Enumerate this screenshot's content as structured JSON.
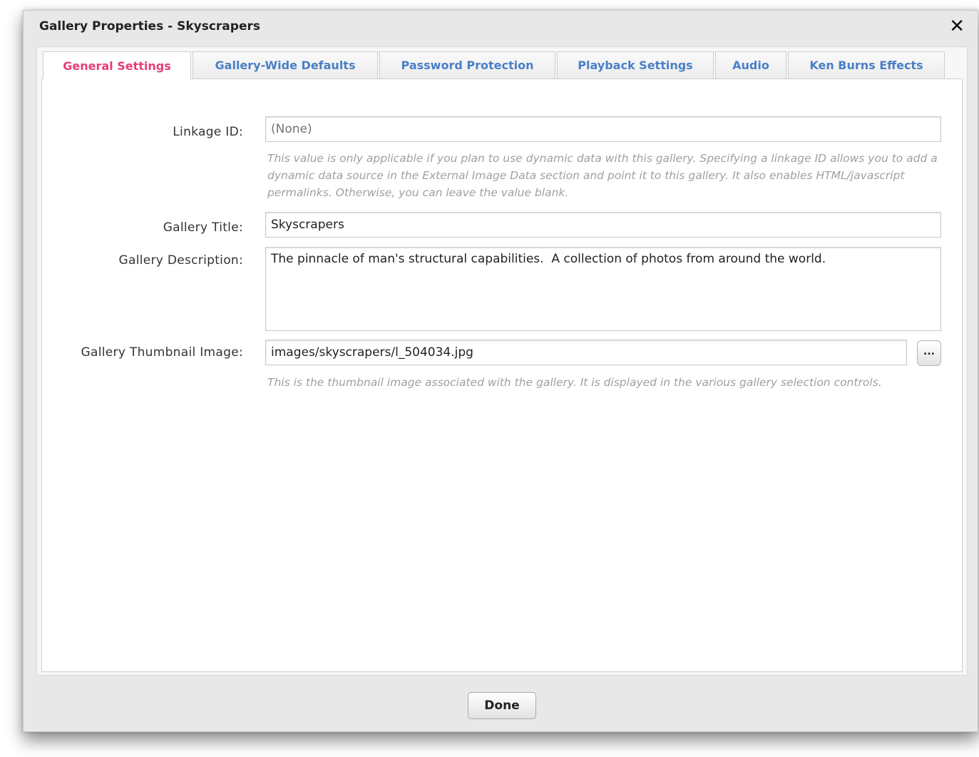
{
  "dialog": {
    "title": "Gallery Properties - Skyscrapers",
    "close_icon": "✕"
  },
  "tabs": [
    {
      "label": "General Settings",
      "active": true
    },
    {
      "label": "Gallery-Wide Defaults",
      "active": false
    },
    {
      "label": "Password Protection",
      "active": false
    },
    {
      "label": "Playback Settings",
      "active": false
    },
    {
      "label": "Audio",
      "active": false
    },
    {
      "label": "Ken Burns Effects",
      "active": false
    }
  ],
  "form": {
    "linkage": {
      "label": "Linkage ID:",
      "placeholder": "(None)",
      "value": "",
      "hint": "This value is only applicable if you plan to use dynamic data with this gallery.  Specifying a linkage ID allows you to add a dynamic data source in the External Image Data section and point it to this gallery. It also enables HTML/javascript permalinks.  Otherwise, you can leave the value blank."
    },
    "title": {
      "label": "Gallery Title:",
      "value": "Skyscrapers"
    },
    "description": {
      "label": "Gallery Description:",
      "value": "The pinnacle of man's structural capabilities.  A collection of photos from around the world."
    },
    "thumbnail": {
      "label": "Gallery Thumbnail Image:",
      "value": "images/skyscrapers/l_504034.jpg",
      "browse_label": "...",
      "hint": "This is the thumbnail image associated with the gallery.  It is displayed in the various gallery selection controls."
    }
  },
  "footer": {
    "done_label": "Done"
  },
  "colors": {
    "active_tab": "#e63d79",
    "inactive_tab": "#4a7fc6"
  }
}
